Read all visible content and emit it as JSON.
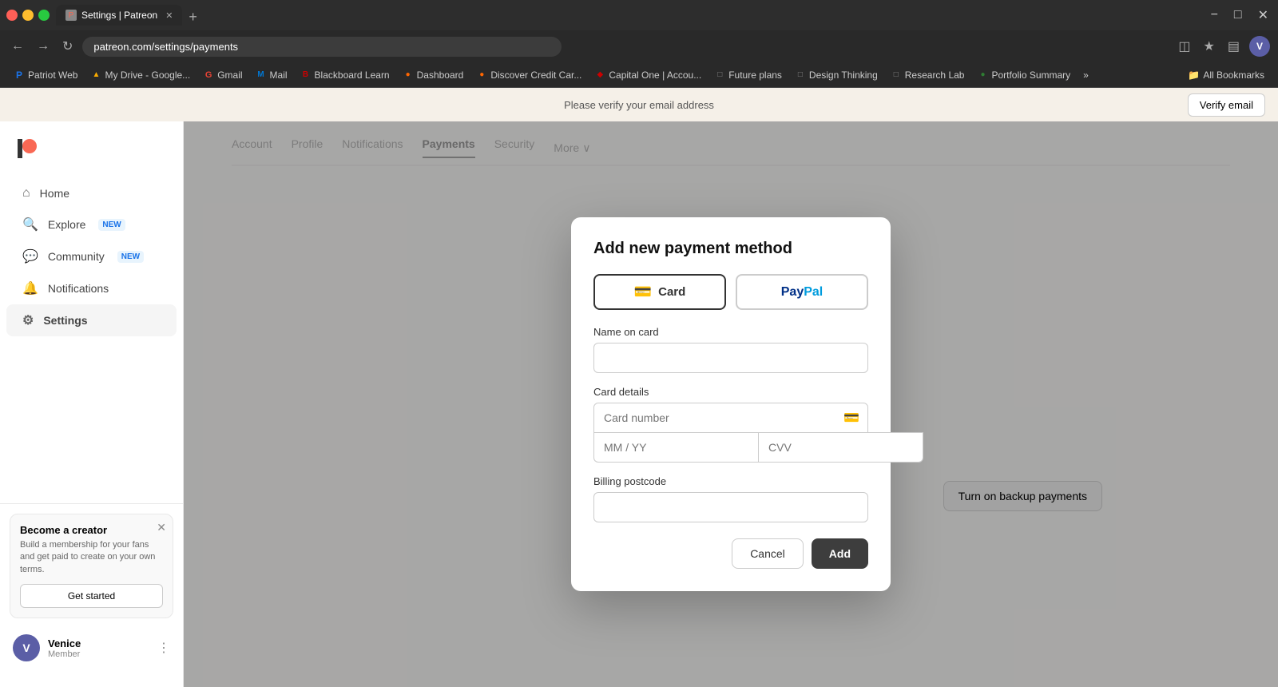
{
  "browser": {
    "tab_title": "Settings | Patreon",
    "url": "patreon.com/settings/payments",
    "new_tab_symbol": "+",
    "close_symbol": "✕",
    "min_symbol": "−",
    "max_symbol": "□"
  },
  "bookmarks": {
    "items": [
      {
        "id": "patriot-web",
        "label": "Patriot Web",
        "favicon_color": "#1a73e8",
        "favicon_char": "P"
      },
      {
        "id": "my-drive",
        "label": "My Drive - Google...",
        "favicon_color": "#f9ab00",
        "favicon_char": "▲"
      },
      {
        "id": "gmail",
        "label": "Gmail",
        "favicon_color": "#ea4335",
        "favicon_char": "G"
      },
      {
        "id": "mail",
        "label": "Mail",
        "favicon_color": "#0078d4",
        "favicon_char": "M"
      },
      {
        "id": "blackboard",
        "label": "Blackboard Learn",
        "favicon_color": "#cc0000",
        "favicon_char": "B"
      },
      {
        "id": "dashboard",
        "label": "Dashboard",
        "favicon_color": "#ff6600",
        "favicon_char": "●"
      },
      {
        "id": "discover",
        "label": "Discover Credit Car...",
        "favicon_color": "#ff6600",
        "favicon_char": "D"
      },
      {
        "id": "capital-one",
        "label": "Capital One | Accou...",
        "favicon_color": "#cc0000",
        "favicon_char": "◆"
      },
      {
        "id": "future-plans",
        "label": "Future plans",
        "favicon_color": "#888",
        "favicon_char": "□"
      },
      {
        "id": "design-thinking",
        "label": "Design Thinking",
        "favicon_color": "#888",
        "favicon_char": "□"
      },
      {
        "id": "research-lab",
        "label": "Research Lab",
        "favicon_color": "#888",
        "favicon_char": "□"
      },
      {
        "id": "portfolio",
        "label": "Portfolio Summary",
        "favicon_color": "#2e7d32",
        "favicon_char": "●"
      }
    ],
    "more_label": "»",
    "all_bookmarks_label": "All Bookmarks"
  },
  "email_banner": {
    "message": "Please verify your email address",
    "verify_button_label": "Verify email"
  },
  "sidebar": {
    "logo_char": "P",
    "nav_items": [
      {
        "id": "home",
        "label": "Home",
        "icon": "⌂"
      },
      {
        "id": "explore",
        "label": "Explore",
        "badge": "NEW",
        "icon": "⚲"
      },
      {
        "id": "community",
        "label": "Community",
        "badge": "NEW",
        "icon": "💬"
      },
      {
        "id": "notifications",
        "label": "Notifications",
        "icon": "🔔"
      },
      {
        "id": "settings",
        "label": "Settings",
        "icon": "⚙",
        "active": true
      }
    ],
    "become_creator": {
      "title": "Become a creator",
      "description": "Build a membership for your fans and get paid to create on your own terms.",
      "button_label": "Get started",
      "close_symbol": "✕"
    },
    "user": {
      "name": "Venice",
      "role": "Member",
      "avatar_letter": "V",
      "more_symbol": "⋮"
    }
  },
  "background_content": {
    "tabs": [
      {
        "id": "account",
        "label": "Account"
      },
      {
        "id": "profile",
        "label": "Profile"
      },
      {
        "id": "notifications",
        "label": "Notifications"
      },
      {
        "id": "payments",
        "label": "Payments",
        "active": true
      },
      {
        "id": "security",
        "label": "Security"
      }
    ],
    "more_label": "More",
    "backup_payments_btn": "Turn on backup payments"
  },
  "modal": {
    "title": "Add new payment method",
    "tabs": [
      {
        "id": "card",
        "label": "Card",
        "icon": "▬",
        "active": true
      },
      {
        "id": "paypal",
        "label": "PayPal",
        "is_paypal": true
      }
    ],
    "form": {
      "name_label": "Name on card",
      "name_placeholder": "",
      "card_details_label": "Card details",
      "card_number_placeholder": "Card number",
      "card_number_icon": "▬",
      "expiry_placeholder": "MM / YY",
      "cvv_placeholder": "CVV",
      "postcode_label": "Billing postcode",
      "postcode_placeholder": ""
    },
    "cancel_label": "Cancel",
    "add_label": "Add"
  }
}
